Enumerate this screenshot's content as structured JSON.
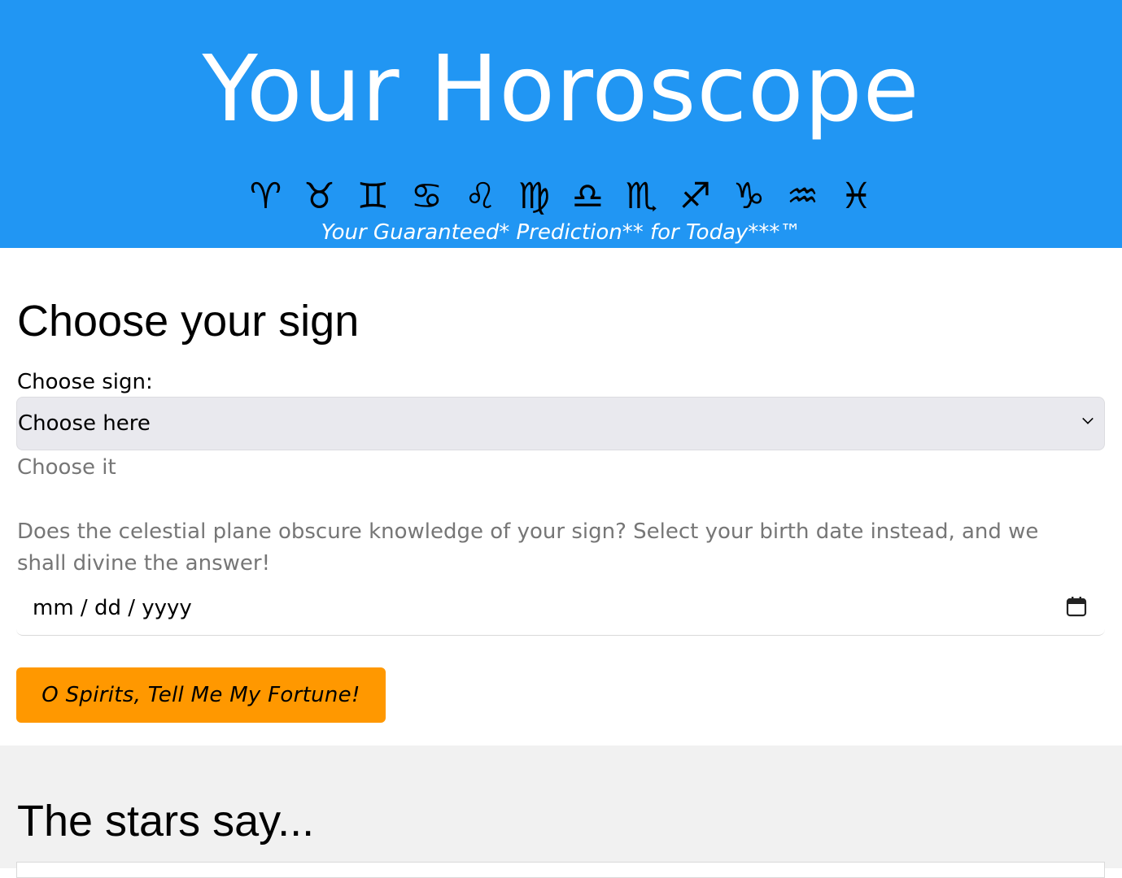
{
  "header": {
    "title": "Your Horoscope",
    "zodiac": [
      "♈",
      "♉",
      "♊",
      "♋",
      "♌",
      "♍",
      "♎",
      "♏",
      "♐",
      "♑",
      "♒",
      "♓"
    ],
    "tagline": "Your Guaranteed* Prediction** for Today***™"
  },
  "choose": {
    "heading": "Choose your sign",
    "sign_label": "Choose sign:",
    "sign_select_value": "Choose here",
    "hint": "Choose it",
    "description": "Does the celestial plane obscure knowledge of your sign? Select your birth date instead, and we shall divine the answer!",
    "date_placeholder": "mm / dd / yyyy",
    "fortune_button": "O Spirits, Tell Me My Fortune!"
  },
  "results": {
    "heading": "The stars say..."
  },
  "colors": {
    "header_bg": "#2196f3",
    "button_bg": "#ff9800",
    "results_bg": "#f1f1f1"
  }
}
